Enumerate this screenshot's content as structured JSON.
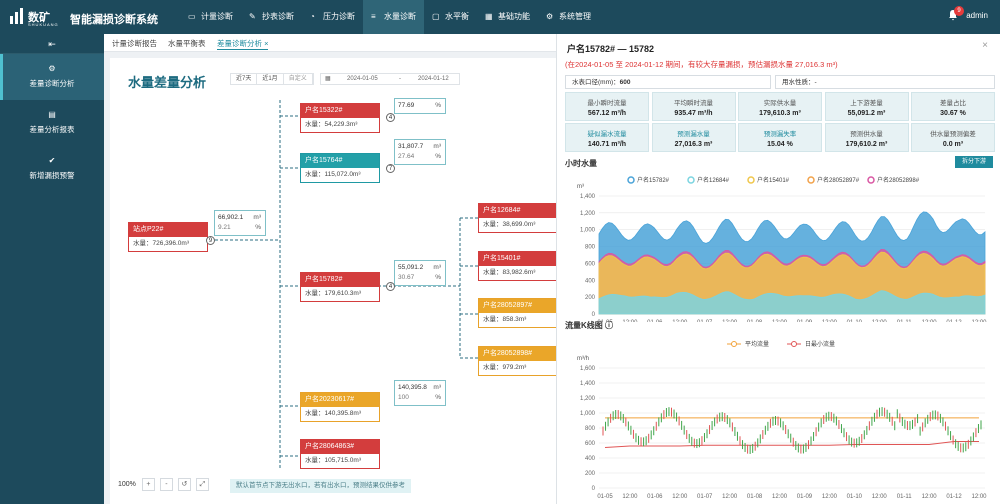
{
  "app": {
    "logo_name": "数矿",
    "logo_sub": "SHUKUANG",
    "title": "智能漏损诊断系统",
    "user": "admin",
    "notify_count": "9"
  },
  "nav": [
    {
      "label": "计量诊断",
      "icon": "monitor-icon"
    },
    {
      "label": "抄表诊断",
      "icon": "edit-icon"
    },
    {
      "label": "压力诊断",
      "icon": "gauge-icon"
    },
    {
      "label": "水量诊断",
      "icon": "list-icon"
    },
    {
      "label": "水平衡",
      "icon": "balance-icon"
    },
    {
      "label": "基础功能",
      "icon": "calendar-icon"
    },
    {
      "label": "系统管理",
      "icon": "gear-icon"
    }
  ],
  "sidebar": {
    "collapse": "⇤",
    "items": [
      {
        "label": "差量诊断分析",
        "icon": "⚙"
      },
      {
        "label": "差量分析报表",
        "icon": "▤"
      },
      {
        "label": "新增漏损预警",
        "icon": "✔"
      }
    ]
  },
  "tabs": [
    "计量诊断报告",
    "水量平衡表",
    "差量诊断分析 ×"
  ],
  "page": {
    "title": "水量差量分析",
    "filters": [
      "近7天",
      "近1月",
      "自定义"
    ],
    "date_from": "2024-01-05",
    "date_sep": "-",
    "date_to": "2024-01-12"
  },
  "nodes": [
    {
      "id": "n1",
      "title": "站点P22#",
      "volume": "水量：726,396.0m³",
      "color": "red"
    },
    {
      "id": "n2",
      "title": "户名15322#",
      "volume": "水量：54,229.3m³",
      "color": "red"
    },
    {
      "id": "n3",
      "title": "户名15764#",
      "volume": "水量：115,072.0m³",
      "color": "teal"
    },
    {
      "id": "n4",
      "title": "户名15782#",
      "volume": "水量：179,610.3m³",
      "color": "red"
    },
    {
      "id": "n5",
      "title": "户名20230617#",
      "volume": "水量：140,395.8m³",
      "color": "orange"
    },
    {
      "id": "n6",
      "title": "户名28064863#",
      "volume": "水量：105,715.0m³",
      "color": "red"
    },
    {
      "id": "n7",
      "title": "户名12684#",
      "volume": "水量：38,699.0m³",
      "color": "red"
    },
    {
      "id": "n8",
      "title": "户名15401#",
      "volume": "水量：83,982.6m³",
      "color": "red"
    },
    {
      "id": "n9",
      "title": "户名28052897#",
      "volume": "水量：858.3m³",
      "color": "orange"
    },
    {
      "id": "n10",
      "title": "户名28052898#",
      "volume": "水量：979.2m³",
      "color": "orange"
    }
  ],
  "ratios": [
    {
      "v1": "66,902.1",
      "u1": "m³",
      "v2": "9.21",
      "u2": "%",
      "count": "9"
    },
    {
      "v1": "77.69",
      "u1": "",
      "v2": "",
      "u2": "%",
      "count": "4"
    },
    {
      "v1": "31,807.7",
      "u1": "m³",
      "v2": "27.64",
      "u2": "%",
      "count": "7"
    },
    {
      "v1": "55,091.2",
      "u1": "m³",
      "v2": "30.67",
      "u2": "%",
      "count": "4"
    },
    {
      "v1": "140,395.8",
      "u1": "m³",
      "v2": "100",
      "u2": "%",
      "count": ""
    }
  ],
  "zoom": {
    "level": "100%",
    "tip": "默认首节点下游无出水口，若有出水口，预测结果仅供参考"
  },
  "panel": {
    "title": "户名15782# — 15782",
    "alert": "(在2024-01-05 至 2024-01-12 期间，有较大存量漏损，预估漏损水量 27,016.3 m³)",
    "meter_label": "水表口径(mm)：",
    "meter_value": "600",
    "use_label": "用水性质：",
    "use_value": "-",
    "stats": [
      {
        "label": "最小瞬时流量",
        "value": "567.12 m³/h",
        "hl": false
      },
      {
        "label": "平均瞬时流量",
        "value": "935.47 m³/h",
        "hl": false
      },
      {
        "label": "实际供水量",
        "value": "179,610.3 m³",
        "hl": false
      },
      {
        "label": "上下游差量",
        "value": "55,091.2 m³",
        "hl": false
      },
      {
        "label": "差量占比",
        "value": "30.67 %",
        "hl": false
      },
      {
        "label": "疑似漏水流量",
        "value": "140.71 m³/h",
        "hl": true
      },
      {
        "label": "预测漏水量",
        "value": "27,016.3 m³",
        "hl": true
      },
      {
        "label": "预测漏失率",
        "value": "15.04 %",
        "hl": true
      },
      {
        "label": "预测供水量",
        "value": "179,610.2 m³",
        "hl": false
      },
      {
        "label": "供水量预测偏差",
        "value": "0.0 m³",
        "hl": false
      }
    ],
    "section1": "小时水量",
    "button": "拆分下游",
    "section2": "流量K线图 ⓘ"
  },
  "colors": {
    "primary": "#1d4a5c",
    "accent": "#1f8b9e",
    "red": "#d33d3d",
    "orange": "#eaa629",
    "teal": "#23a0a8"
  },
  "chart_data": [
    {
      "type": "area",
      "title": "小时水量",
      "ylabel": "m³",
      "ylim": [
        0,
        1400
      ],
      "yticks": [
        "0",
        "200",
        "400",
        "600",
        "800",
        "1,000",
        "1,200",
        "1,400"
      ],
      "x": [
        "01-05",
        "12:00",
        "01-06",
        "12:00",
        "01-07",
        "12:00",
        "01-08",
        "12:00",
        "01-09",
        "12:00",
        "01-10",
        "12:00",
        "01-11",
        "12:00",
        "01-12",
        "12:00"
      ],
      "series": [
        {
          "name": "户名15782#",
          "color": "#4aa3d8",
          "values": [
            950,
            1000,
            950,
            1020,
            940,
            1010,
            960,
            1030,
            950,
            1000,
            960,
            1040,
            980,
            1150,
            1000,
            1080
          ]
        },
        {
          "name": "户名12684#",
          "color": "#7bd4e0",
          "values": [
            180,
            240,
            180,
            250,
            190,
            240,
            180,
            250,
            190,
            240,
            180,
            250,
            190,
            240,
            180,
            250
          ]
        },
        {
          "name": "户名15401#",
          "color": "#f0c64b",
          "values": [
            600,
            650,
            600,
            660,
            600,
            650,
            610,
            660,
            600,
            650,
            610,
            660,
            600,
            670,
            600,
            660
          ]
        },
        {
          "name": "户名28052897#",
          "color": "#f1a24a",
          "values": [
            5,
            5,
            5,
            5,
            5,
            5,
            5,
            5,
            5,
            5,
            5,
            5,
            5,
            5,
            5,
            5
          ]
        },
        {
          "name": "户名28052898#",
          "color": "#d957a3",
          "values": [
            620,
            680,
            620,
            690,
            620,
            680,
            630,
            690,
            620,
            680,
            630,
            690,
            620,
            700,
            620,
            690
          ]
        }
      ]
    },
    {
      "type": "line",
      "title": "流量K线图",
      "ylabel": "m³/h",
      "ylim": [
        0,
        1600
      ],
      "yticks": [
        "0",
        "200",
        "400",
        "600",
        "800",
        "1,000",
        "1,200",
        "1,400",
        "1,600"
      ],
      "x": [
        "01-05",
        "12:00",
        "01-06",
        "12:00",
        "01-07",
        "12:00",
        "01-08",
        "12:00",
        "01-09",
        "12:00",
        "01-10",
        "12:00",
        "01-11",
        "12:00",
        "01-12",
        "12:00"
      ],
      "series": [
        {
          "name": "平均流量",
          "color": "#f2a23a",
          "values": [
            935,
            935,
            935,
            935,
            935,
            935,
            935,
            935,
            935,
            935,
            935,
            935,
            935,
            935,
            935,
            935
          ]
        },
        {
          "name": "日最小流量",
          "color": "#e05555",
          "values": [
            540,
            560,
            560,
            560,
            570,
            570,
            570,
            570,
            570,
            570,
            580,
            580,
            580,
            580,
            620,
            620
          ]
        }
      ]
    }
  ]
}
